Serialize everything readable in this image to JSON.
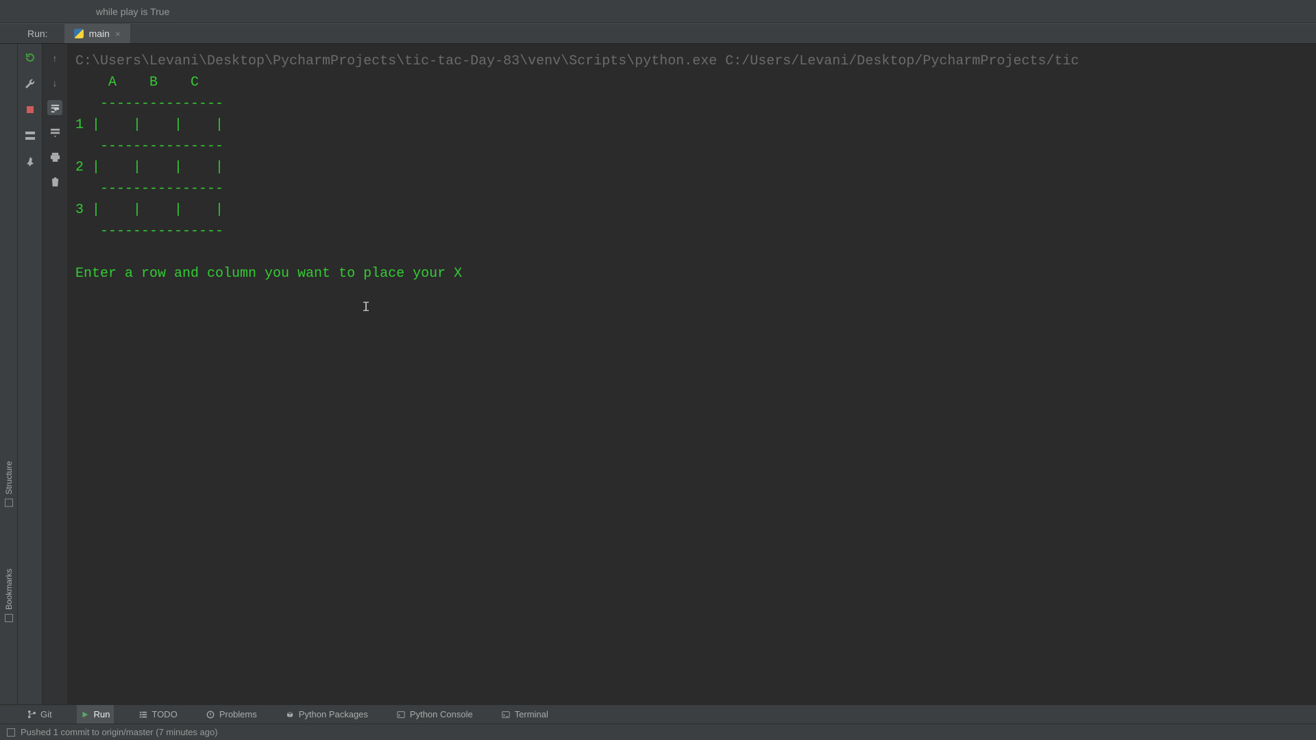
{
  "breadcrumb": {
    "text": "while play is True"
  },
  "runbar": {
    "label": "Run:",
    "tab": "main"
  },
  "leftstrip": {
    "structure": "Structure",
    "bookmarks": "Bookmarks"
  },
  "console": {
    "path": "C:\\Users\\Levani\\Desktop\\PycharmProjects\\tic-tac-Day-83\\venv\\Scripts\\python.exe C:/Users/Levani/Desktop/PycharmProjects/tic",
    "lines": [
      "    A    B    C",
      "   ---------------",
      "1 |    |    |    |",
      "   ---------------",
      "2 |    |    |    |",
      "   ---------------",
      "3 |    |    |    |",
      "   ---------------",
      "",
      "Enter a row and column you want to place your X "
    ]
  },
  "bottombar": {
    "git": "Git",
    "run": "Run",
    "todo": "TODO",
    "problems": "Problems",
    "packages": "Python Packages",
    "pyconsole": "Python Console",
    "terminal": "Terminal"
  },
  "statusbar": {
    "msg": "Pushed 1 commit to origin/master (7 minutes ago)"
  }
}
